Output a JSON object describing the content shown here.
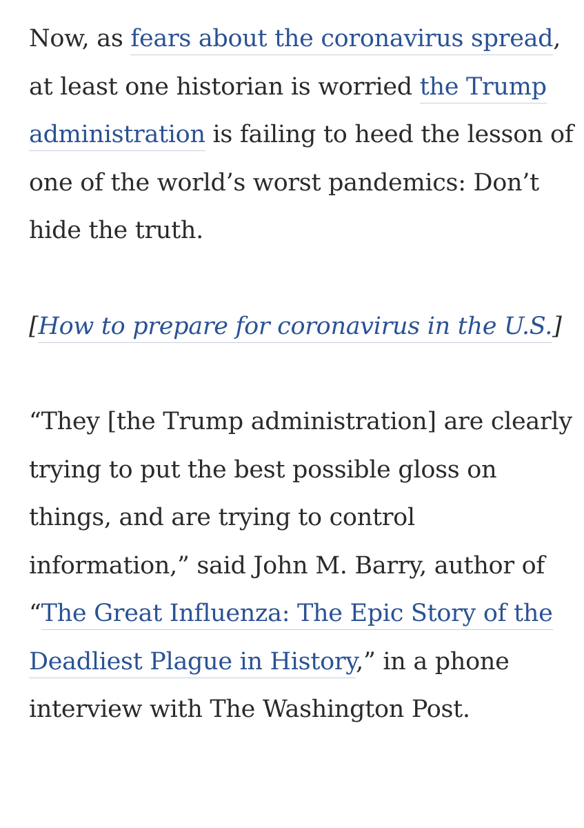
{
  "article": {
    "paragraph1": {
      "t1": "Now, as ",
      "link1": "fears about the coronavirus spread",
      "t2": ", at least one historian is worried ",
      "link2": "the Trump administration",
      "t3": " is failing to heed the lesson of one of the world’s worst pandemics: Don’t hide the truth."
    },
    "related": {
      "open": "[",
      "link": "How to prepare for coronavirus in the U.S.",
      "close": "]"
    },
    "paragraph3": {
      "t1": "“They [the Trump administration] are clearly trying to put the best possible gloss on things, and are trying to control information,” said John M. Barry, author of “",
      "link": "The Great Influenza: The Epic Story of the Deadliest Plague in History",
      "t2": ",” in a phone interview with The Washington Post."
    }
  },
  "colors": {
    "text": "#2a2a2a",
    "link": "#2a5294",
    "link_underline": "#c6cfdd",
    "background": "#ffffff"
  }
}
